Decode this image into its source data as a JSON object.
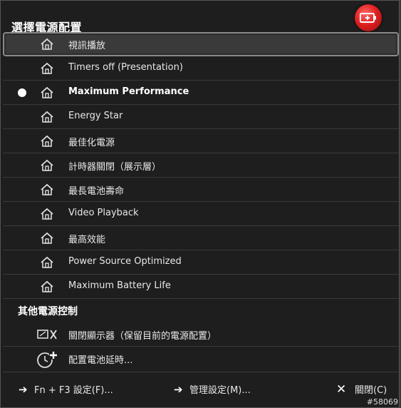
{
  "title": "選擇電源配置",
  "battery_icon": "battery-charging-icon",
  "plans": [
    {
      "label": "視訊播放",
      "selected_focus": true,
      "active": false,
      "bold": false
    },
    {
      "label": "Timers off (Presentation)",
      "selected_focus": false,
      "active": false,
      "bold": false
    },
    {
      "label": "Maximum Performance",
      "selected_focus": false,
      "active": true,
      "bold": true
    },
    {
      "label": "Energy Star",
      "selected_focus": false,
      "active": false,
      "bold": false
    },
    {
      "label": "最佳化電源",
      "selected_focus": false,
      "active": false,
      "bold": false
    },
    {
      "label": "計時器關閉（展示層）",
      "selected_focus": false,
      "active": false,
      "bold": false
    },
    {
      "label": "最長電池壽命",
      "selected_focus": false,
      "active": false,
      "bold": false
    },
    {
      "label": "Video Playback",
      "selected_focus": false,
      "active": false,
      "bold": false
    },
    {
      "label": "最高效能",
      "selected_focus": false,
      "active": false,
      "bold": false
    },
    {
      "label": "Power Source Optimized",
      "selected_focus": false,
      "active": false,
      "bold": false
    },
    {
      "label": "Maximum Battery Life",
      "selected_focus": false,
      "active": false,
      "bold": false
    }
  ],
  "other_section": {
    "title": "其他電源控制",
    "items": [
      {
        "label": "關閉顯示器（保留目前的電源配置）",
        "icon": "display-off-icon"
      },
      {
        "label": "配置電池延時...",
        "icon": "timer-add-icon"
      }
    ]
  },
  "footer": {
    "fn_label": "Fn + F3 設定(F)...",
    "manage_label": "管理設定(M)...",
    "close_label": "關閉(C)"
  },
  "id_tag": "#58069"
}
